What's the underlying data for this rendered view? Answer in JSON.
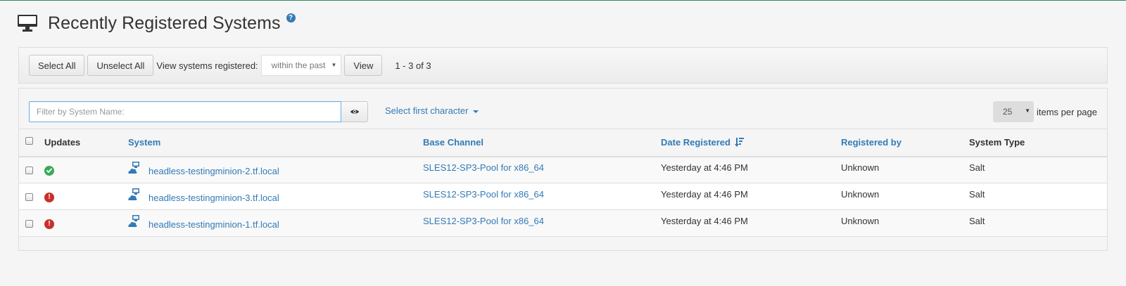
{
  "header": {
    "title": "Recently Registered Systems",
    "help_symbol": "?"
  },
  "toolbar": {
    "select_all": "Select All",
    "unselect_all": "Unselect All",
    "view_label": "View systems registered:",
    "range_selected": "within the past",
    "view_button": "View",
    "paging": "1 - 3 of 3"
  },
  "filter": {
    "placeholder": "Filter by System Name:",
    "first_character": "Select first character",
    "items_per_page": "25",
    "items_per_page_label": "items per page"
  },
  "table": {
    "columns": [
      "Updates",
      "System",
      "Base Channel",
      "Date Registered",
      "Registered by",
      "System Type"
    ],
    "rows": [
      {
        "status": "ok",
        "system": "headless-testingminion-2.tf.local",
        "channel": "SLES12-SP3-Pool for x86_64",
        "date": "Yesterday at 4:46 PM",
        "registered_by": "Unknown",
        "type": "Salt"
      },
      {
        "status": "error",
        "system": "headless-testingminion-3.tf.local",
        "channel": "SLES12-SP3-Pool for x86_64",
        "date": "Yesterday at 4:46 PM",
        "registered_by": "Unknown",
        "type": "Salt"
      },
      {
        "status": "error",
        "system": "headless-testingminion-1.tf.local",
        "channel": "SLES12-SP3-Pool for x86_64",
        "date": "Yesterday at 4:46 PM",
        "registered_by": "Unknown",
        "type": "Salt"
      }
    ]
  },
  "colors": {
    "link": "#337ab7",
    "ok": "#3aaa5a",
    "error": "#c9302c",
    "top_border": "#2e8b57"
  }
}
